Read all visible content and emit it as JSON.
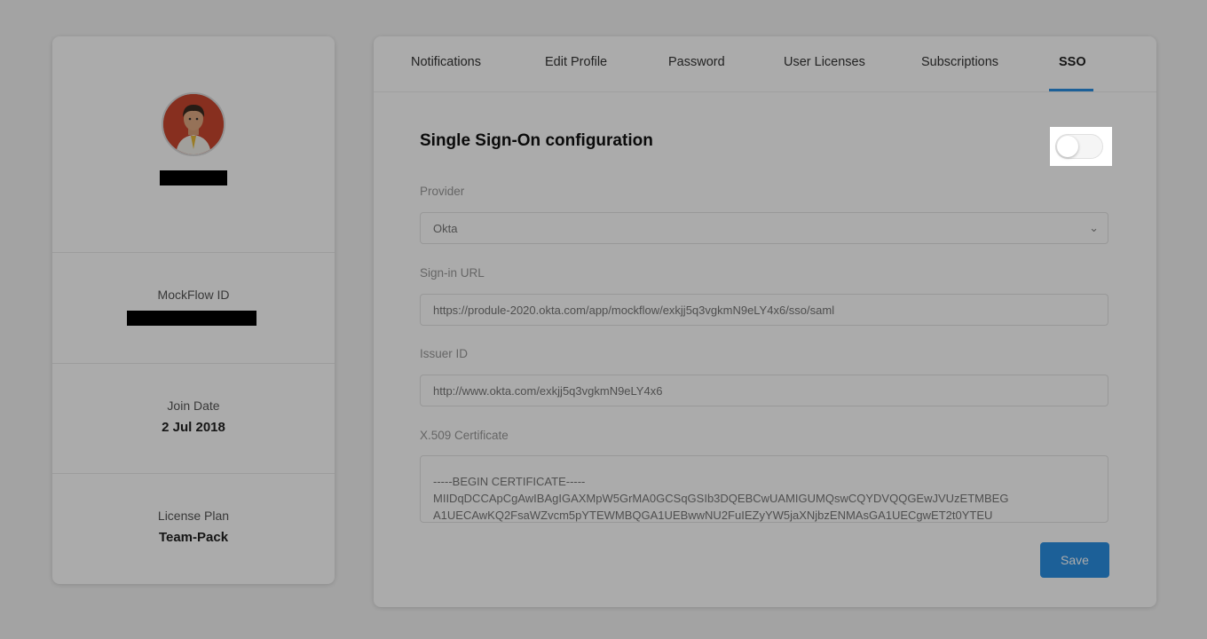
{
  "profile": {
    "avatar_icon": "user-avatar-icon",
    "mockflow_id_label": "MockFlow ID",
    "join_date_label": "Join Date",
    "join_date_value": "2 Jul 2018",
    "license_plan_label": "License Plan",
    "license_plan_value": "Team-Pack"
  },
  "tabs": [
    {
      "label": "Notifications"
    },
    {
      "label": "Edit Profile"
    },
    {
      "label": "Password"
    },
    {
      "label": "User Licenses"
    },
    {
      "label": "Subscriptions"
    },
    {
      "label": "SSO",
      "active": true
    }
  ],
  "sso": {
    "title": "Single Sign-On configuration",
    "enabled": false,
    "provider_label": "Provider",
    "provider_value": "Okta",
    "signin_url_label": "Sign-in URL",
    "signin_url_value": "https://produle-2020.okta.com/app/mockflow/exkjj5q3vgkmN9eLY4x6/sso/saml",
    "issuer_id_label": "Issuer ID",
    "issuer_id_value": "http://www.okta.com/exkjj5q3vgkmN9eLY4x6",
    "certificate_label": "X.509 Certificate",
    "certificate_lines": [
      "-----BEGIN CERTIFICATE-----",
      "MIIDqDCCApCgAwIBAgIGAXMpW5GrMA0GCSqGSIb3DQEBCwUAMIGUMQswCQYDVQQGEwJVUzETMBEG",
      "A1UECAwKQ2FsaWZvcm5pYTEWMBQGA1UEBwwNU2FuIEZyYW5jaXNjbzENMAsGA1UECgwET2t0YTEU"
    ],
    "save_label": "Save"
  },
  "colors": {
    "accent": "#2b8fe3",
    "overlay": "rgba(0,0,0,0.33)"
  }
}
